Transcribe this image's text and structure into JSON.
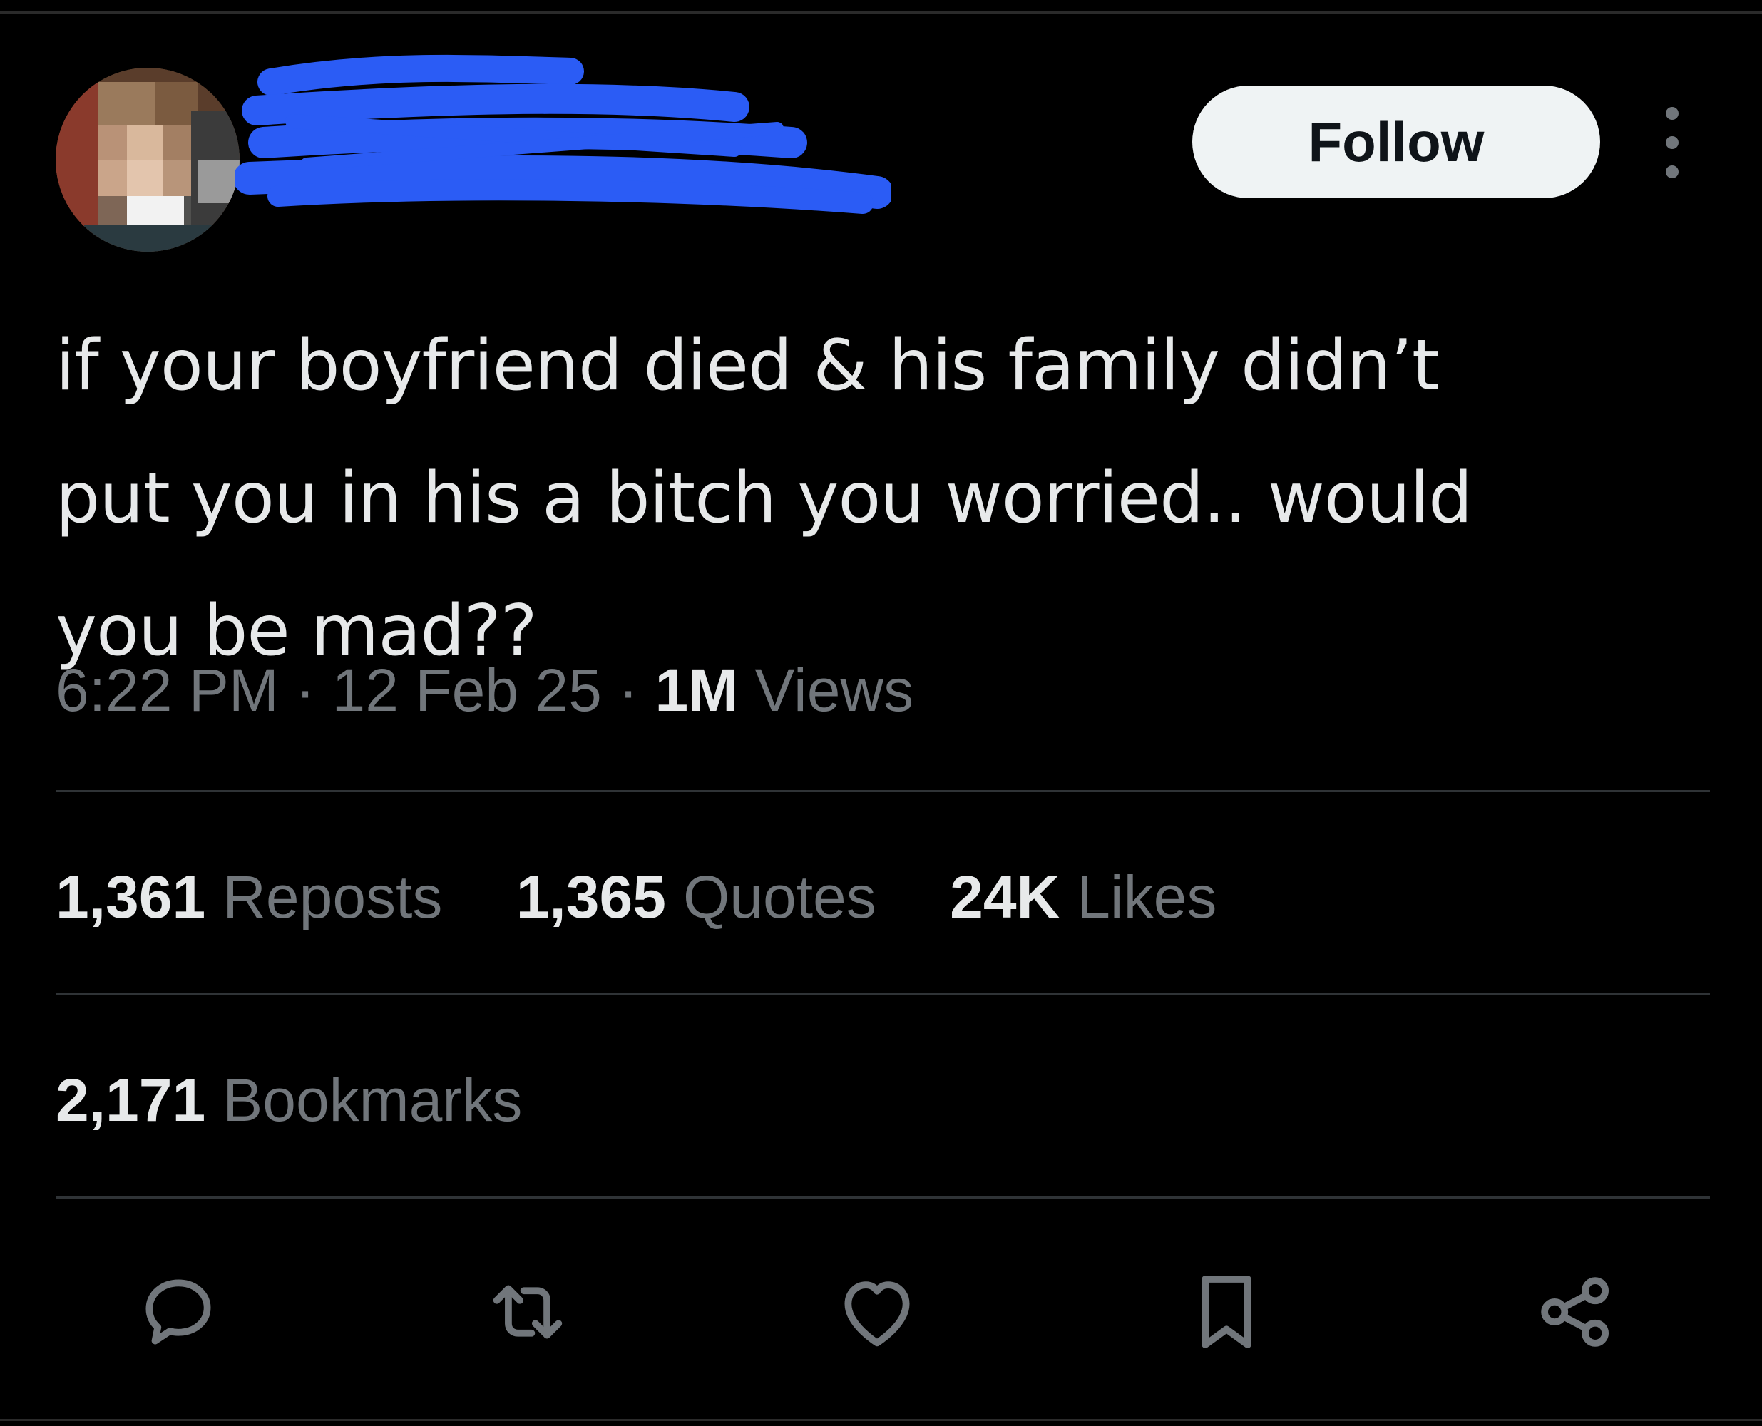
{
  "colors": {
    "background": "#000000",
    "text_primary": "#e7e9ea",
    "text_secondary": "#71767b",
    "divider": "#2f3336",
    "follow_bg": "#eff3f4",
    "redaction_blue": "#2b5cf5"
  },
  "header": {
    "avatar_icon": "avatar-pixelated",
    "follow_label": "Follow",
    "more_icon": "more-vertical-icon"
  },
  "tweet": {
    "text": "if your boyfriend died & his family didn’t\nput you in his a bitch you worried.. would\nyou be mad??",
    "time": "6:22 PM",
    "date": "12 Feb 25",
    "views_count": "1M",
    "views_label": "Views",
    "separator": "·"
  },
  "stats": {
    "reposts_count": "1,361",
    "reposts_label": "Reposts",
    "quotes_count": "1,365",
    "quotes_label": "Quotes",
    "likes_count": "24K",
    "likes_label": "Likes",
    "bookmarks_count": "2,171",
    "bookmarks_label": "Bookmarks"
  },
  "actions": [
    {
      "icon": "reply-icon"
    },
    {
      "icon": "repost-icon"
    },
    {
      "icon": "like-icon"
    },
    {
      "icon": "bookmark-icon"
    },
    {
      "icon": "share-icon"
    }
  ]
}
